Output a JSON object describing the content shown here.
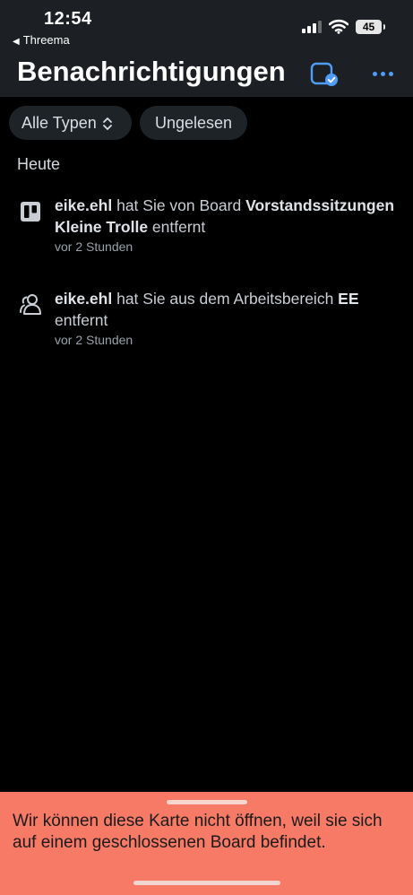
{
  "status_bar": {
    "time": "12:54",
    "back_app": "Threema",
    "battery": "45"
  },
  "header": {
    "title": "Benachrichtigungen"
  },
  "filters": {
    "type_label": "Alle Typen",
    "unread_label": "Ungelesen"
  },
  "sections": [
    {
      "heading": "Heute",
      "items": [
        {
          "icon": "board-icon",
          "user": "eike.ehl",
          "text_before": " hat Sie von Board ",
          "target": "Vorstandssitzungen Kleine Trolle",
          "text_after": " entfernt",
          "time": "vor 2 Stunden"
        },
        {
          "icon": "workspace-members-icon",
          "user": "eike.ehl",
          "text_before": " hat Sie aus dem Arbeitsbereich ",
          "target": "EE",
          "text_after": " entfernt",
          "time": "vor 2 Stunden"
        }
      ]
    }
  ],
  "toast": {
    "message": "Wir können diese Karte nicht öffnen, weil sie sich auf einem geschlossenen Board befindet."
  },
  "colors": {
    "header_bg": "#1c2024",
    "accent": "#4f9cf9",
    "toast_bg": "#f77a66"
  }
}
